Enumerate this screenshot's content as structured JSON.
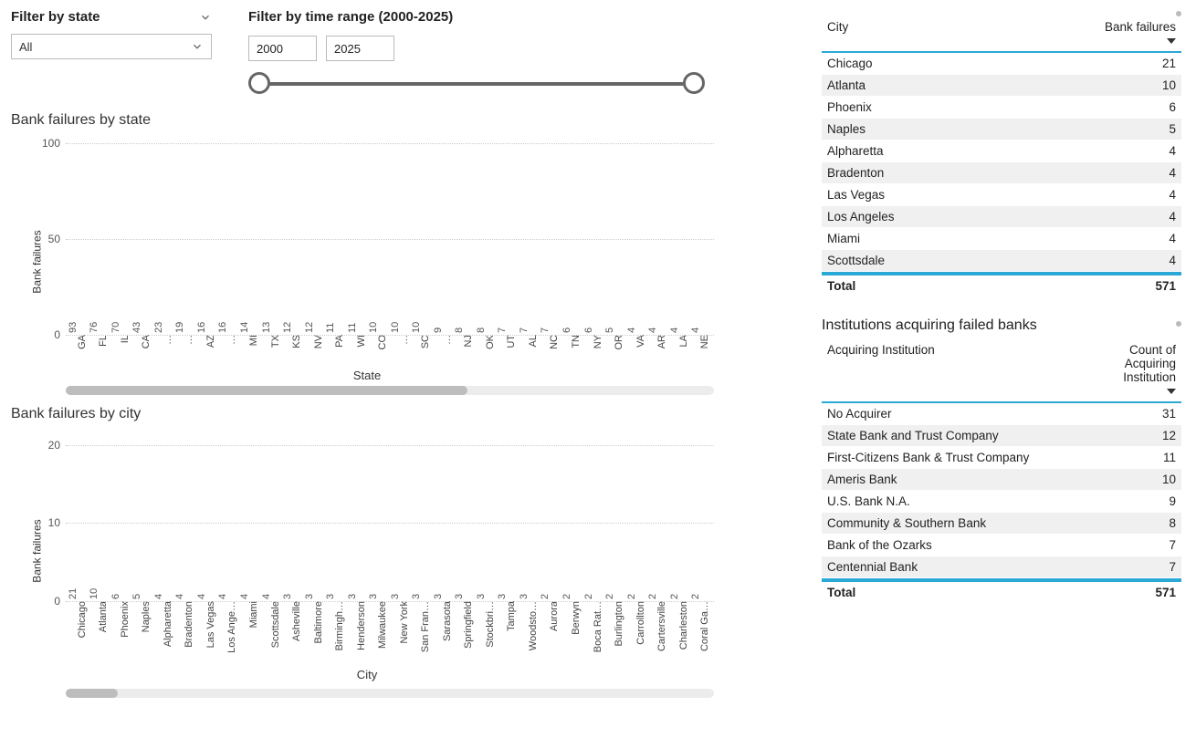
{
  "filters": {
    "state_label": "Filter by state",
    "state_value": "All",
    "range_label": "Filter by time range (2000-2025)",
    "year_from": "2000",
    "year_to": "2025"
  },
  "chart_data": [
    {
      "type": "bar",
      "title": "Bank failures by state",
      "xlabel": "State",
      "ylabel": "Bank failures",
      "ylim": [
        0,
        100
      ],
      "yticks": [
        0,
        50,
        100
      ],
      "categories": [
        "GA",
        "FL",
        "IL",
        "CA",
        "…",
        "…",
        "AZ",
        "…",
        "MI",
        "TX",
        "KS",
        "NV",
        "PA",
        "WI",
        "CO",
        "…",
        "SC",
        "…",
        "NJ",
        "OK",
        "UT",
        "AL",
        "NC",
        "TN",
        "NY",
        "OR",
        "VA",
        "AR",
        "LA",
        "NE"
      ],
      "values": [
        93,
        76,
        70,
        43,
        23,
        19,
        16,
        16,
        14,
        13,
        12,
        12,
        11,
        11,
        10,
        10,
        10,
        9,
        8,
        8,
        7,
        7,
        7,
        6,
        6,
        5,
        4,
        4,
        4,
        4
      ],
      "scroll_thumb": {
        "left_pct": 0,
        "width_pct": 62
      }
    },
    {
      "type": "bar",
      "title": "Bank failures by city",
      "xlabel": "City",
      "ylabel": "Bank failures",
      "ylim": [
        0,
        21
      ],
      "yticks": [
        0,
        10,
        20
      ],
      "categories": [
        "Chicago",
        "Atlanta",
        "Phoenix",
        "Naples",
        "Alpharetta",
        "Bradenton",
        "Las Vegas",
        "Los Ange…",
        "Miami",
        "Scottsdale",
        "Asheville",
        "Baltimore",
        "Birmingh…",
        "Henderson",
        "Milwaukee",
        "New York",
        "San Fran…",
        "Sarasota",
        "Springfield",
        "Stockbri…",
        "Tampa",
        "Woodsto…",
        "Aurora",
        "Berwyn",
        "Boca Rat…",
        "Burlington",
        "Carrollton",
        "Cartersville",
        "Charleston",
        "Coral Ga…"
      ],
      "values": [
        21,
        10,
        6,
        5,
        4,
        4,
        4,
        4,
        4,
        4,
        3,
        3,
        3,
        3,
        3,
        3,
        3,
        3,
        3,
        3,
        3,
        3,
        2,
        2,
        2,
        2,
        2,
        2,
        2,
        2
      ],
      "scroll_thumb": {
        "left_pct": 0,
        "width_pct": 8
      }
    }
  ],
  "city_table": {
    "col1": "City",
    "col2": "Bank failures",
    "rows": [
      {
        "city": "Chicago",
        "n": 21
      },
      {
        "city": "Atlanta",
        "n": 10
      },
      {
        "city": "Phoenix",
        "n": 6
      },
      {
        "city": "Naples",
        "n": 5
      },
      {
        "city": "Alpharetta",
        "n": 4
      },
      {
        "city": "Bradenton",
        "n": 4
      },
      {
        "city": "Las Vegas",
        "n": 4
      },
      {
        "city": "Los Angeles",
        "n": 4
      },
      {
        "city": "Miami",
        "n": 4
      },
      {
        "city": "Scottsdale",
        "n": 4
      }
    ],
    "total_label": "Total",
    "total_value": 571
  },
  "institutions": {
    "title": "Institutions acquiring failed banks",
    "col1": "Acquiring Institution",
    "col2": "Count of Acquiring Institution",
    "rows": [
      {
        "inst": "No Acquirer",
        "n": 31
      },
      {
        "inst": "State Bank and Trust Company",
        "n": 12
      },
      {
        "inst": "First-Citizens Bank & Trust Company",
        "n": 11
      },
      {
        "inst": "Ameris Bank",
        "n": 10
      },
      {
        "inst": "U.S. Bank N.A.",
        "n": 9
      },
      {
        "inst": "Community & Southern Bank",
        "n": 8
      },
      {
        "inst": "Bank of the Ozarks",
        "n": 7
      },
      {
        "inst": "Centennial Bank",
        "n": 7
      }
    ],
    "total_label": "Total",
    "total_value": 571
  }
}
